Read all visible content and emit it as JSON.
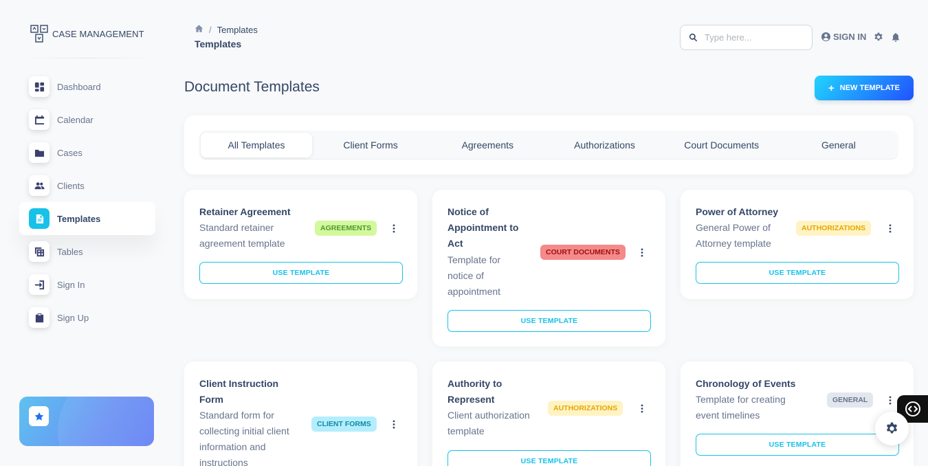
{
  "brand": {
    "name": "CASE MANAGEMENT",
    "logo_icon": "case-logo-icon"
  },
  "sidebar": {
    "items": [
      {
        "label": "Dashboard",
        "icon": "dashboard-icon"
      },
      {
        "label": "Calendar",
        "icon": "calendar-icon"
      },
      {
        "label": "Cases",
        "icon": "folder-icon"
      },
      {
        "label": "Clients",
        "icon": "people-icon"
      },
      {
        "label": "Templates",
        "icon": "document-icon",
        "active": true
      },
      {
        "label": "Tables",
        "icon": "table-icon"
      },
      {
        "label": "Sign In",
        "icon": "login-icon"
      },
      {
        "label": "Sign Up",
        "icon": "clipboard-icon"
      }
    ],
    "help_card_icon": "star-icon"
  },
  "topbar": {
    "breadcrumb": {
      "home_icon": "home-icon",
      "separator": "/",
      "current": "Templates"
    },
    "page_title": "Templates",
    "search": {
      "placeholder": "Type here...",
      "value": ""
    },
    "sign_in_label": "SIGN IN"
  },
  "main": {
    "title": "Document Templates",
    "new_button_label": "NEW TEMPLATE",
    "new_button_prefix": "+",
    "tabs": [
      {
        "label": "All Templates",
        "active": true
      },
      {
        "label": "Client Forms"
      },
      {
        "label": "Agreements"
      },
      {
        "label": "Authorizations"
      },
      {
        "label": "Court Documents"
      },
      {
        "label": "General"
      }
    ],
    "use_template_label": "USE TEMPLATE",
    "templates": [
      {
        "title_lines": [
          "Retainer Agreement"
        ],
        "desc_lines": [
          "Standard retainer",
          "agreement template"
        ],
        "badge": "AGREEMENTS"
      },
      {
        "title_lines": [
          "Notice of",
          "Appointment to",
          "Act"
        ],
        "desc_lines": [
          "Template for",
          "notice of",
          "appointment"
        ],
        "badge": "COURT DOCUMENTS"
      },
      {
        "title_lines": [
          "Power of Attorney"
        ],
        "desc_lines": [
          "General Power of",
          "Attorney template"
        ],
        "badge": "AUTHORIZATIONS"
      },
      {
        "title_lines": [
          "Client Instruction",
          "Form"
        ],
        "desc_lines": [
          "Standard form for",
          "collecting initial client",
          "information and",
          "instructions"
        ],
        "badge": "CLIENT FORMS"
      },
      {
        "title_lines": [
          "Authority to",
          "Represent"
        ],
        "desc_lines": [
          "Client authorization",
          "template"
        ],
        "badge": "AUTHORIZATIONS"
      },
      {
        "title_lines": [
          "Chronology of Events"
        ],
        "desc_lines": [
          "Template for creating",
          "event timelines"
        ],
        "badge": "GENERAL"
      }
    ]
  },
  "colors": {
    "accent": "#17c1e8",
    "text": "#344767",
    "muted": "#67748e",
    "background": "#f8f9fa"
  }
}
